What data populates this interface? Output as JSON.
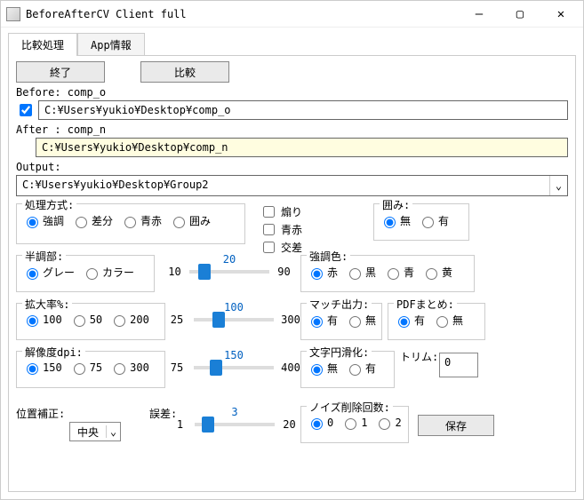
{
  "window": {
    "title": "BeforeAfterCV Client full"
  },
  "tabs": {
    "compare": "比較処理",
    "info": "App情報"
  },
  "buttons": {
    "exit": "終了",
    "compare": "比較",
    "save": "保存"
  },
  "before": {
    "label": "Before: comp_o",
    "checked": true,
    "path": "C:¥Users¥yukio¥Desktop¥comp_o"
  },
  "after": {
    "label": "After : comp_n",
    "path": "C:¥Users¥yukio¥Desktop¥comp_n"
  },
  "output": {
    "label": "Output:",
    "path": "C:¥Users¥yukio¥Desktop¥Group2"
  },
  "method": {
    "label": "処理方式:",
    "options": {
      "emph": "強調",
      "diff": "差分",
      "br": "青赤",
      "kakomi": "囲み"
    },
    "selected": "emph"
  },
  "checks": {
    "aori": "煽り",
    "seiseki": "青赤",
    "kousa": "交差"
  },
  "enclose": {
    "label": "囲み:",
    "none": "無",
    "yes": "有",
    "selected": "none"
  },
  "halftone": {
    "label": "半調部:",
    "gray": "グレー",
    "color": "カラー",
    "selected": "gray"
  },
  "slider_ht": {
    "min": "10",
    "max": "90",
    "value": "20"
  },
  "emcolor": {
    "label": "強調色:",
    "red": "赤",
    "black": "黒",
    "blue": "青",
    "yellow": "黄",
    "selected": "red"
  },
  "zoom": {
    "label": "拡大率%:",
    "o100": "100",
    "o50": "50",
    "o200": "200",
    "selected": "100"
  },
  "slider_zoom": {
    "min": "25",
    "max": "300",
    "value": "100"
  },
  "match": {
    "label": "マッチ出力:",
    "yes": "有",
    "no": "無",
    "selected": "yes"
  },
  "pdf": {
    "label": "PDFまとめ:",
    "yes": "有",
    "no": "無",
    "selected": "yes"
  },
  "dpi": {
    "label": "解像度dpi:",
    "o150": "150",
    "o75": "75",
    "o300": "300",
    "selected": "150"
  },
  "slider_dpi": {
    "min": "75",
    "max": "400",
    "value": "150"
  },
  "smooth": {
    "label": "文字円滑化:",
    "no": "無",
    "yes": "有",
    "selected": "no"
  },
  "trim": {
    "label": "トリム:",
    "value": "0"
  },
  "pos": {
    "label": "位置補正:",
    "value": "中央"
  },
  "err": {
    "label": "誤差:"
  },
  "slider_err": {
    "min": "1",
    "max": "20",
    "value": "3"
  },
  "noise": {
    "label": "ノイズ削除回数:",
    "o0": "0",
    "o1": "1",
    "o2": "2",
    "selected": "0"
  }
}
